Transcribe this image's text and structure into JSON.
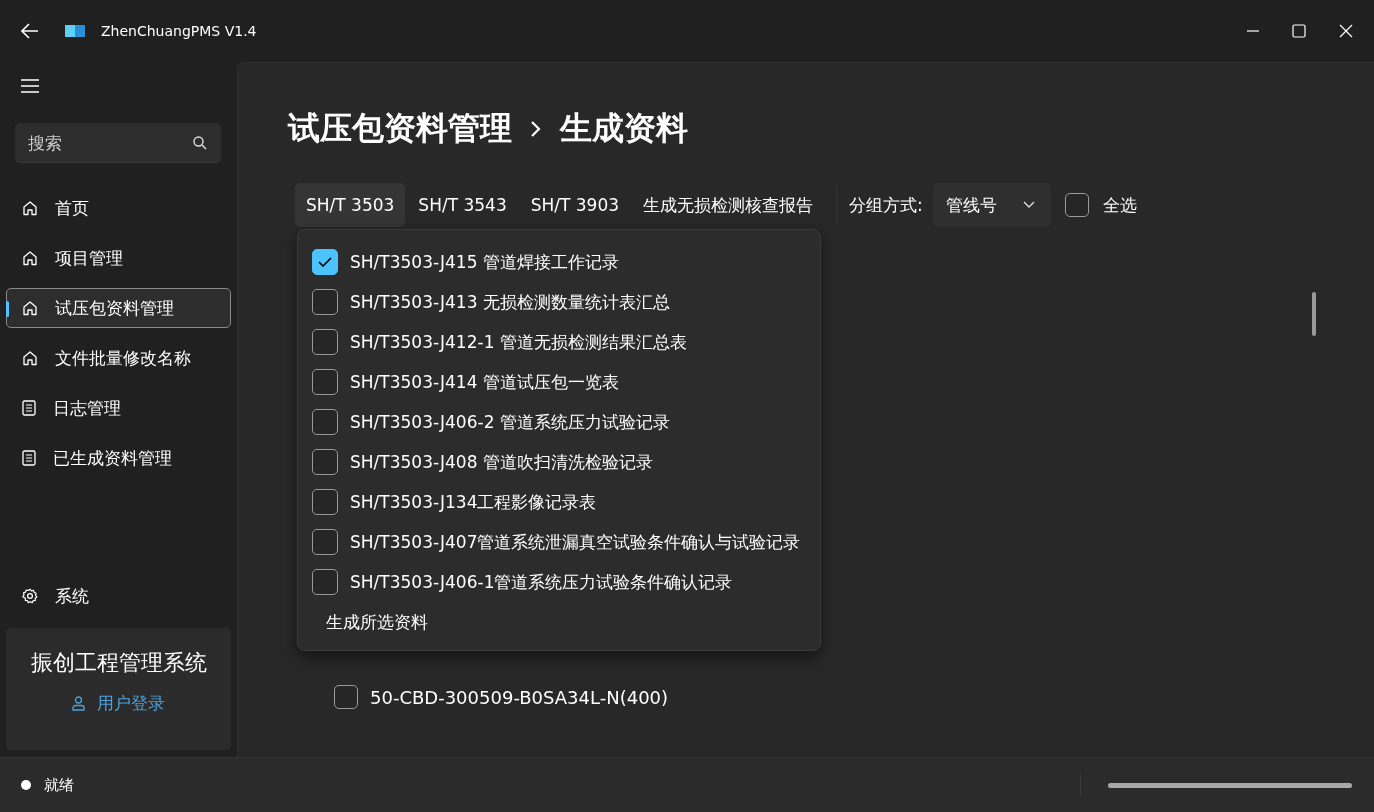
{
  "window": {
    "title": "ZhenChuangPMS V1.4"
  },
  "sidebar": {
    "search": {
      "placeholder": "搜索"
    },
    "items": [
      {
        "label": "首页",
        "kind": "home",
        "selected": false
      },
      {
        "label": "项目管理",
        "kind": "home",
        "selected": false
      },
      {
        "label": "试压包资料管理",
        "kind": "home",
        "selected": true
      },
      {
        "label": "文件批量修改名称",
        "kind": "home",
        "selected": false
      },
      {
        "label": "日志管理",
        "kind": "document",
        "selected": false
      },
      {
        "label": "已生成资料管理",
        "kind": "document",
        "selected": false
      }
    ],
    "footer_item": {
      "label": "系统"
    },
    "card": {
      "title": "振创工程管理系统",
      "login": "用户登录"
    }
  },
  "breadcrumb": [
    "试压包资料管理",
    "生成资料"
  ],
  "toolbar": {
    "tabs": [
      {
        "label": "SH/T 3503",
        "selected": true
      },
      {
        "label": "SH/T 3543",
        "selected": false
      },
      {
        "label": "SH/T 3903",
        "selected": false
      },
      {
        "label": "生成无损检测核查报告",
        "selected": false
      }
    ],
    "group_label": "分组方式:",
    "group_select": {
      "value": "管线号"
    },
    "select_all": {
      "label": "全选",
      "checked": false
    }
  },
  "flyout": {
    "items": [
      {
        "label": "SH/T3503-J415 管道焊接工作记录",
        "checked": true
      },
      {
        "label": "SH/T3503-J413 无损检测数量统计表汇总",
        "checked": false
      },
      {
        "label": "SH/T3503-J412-1 管道无损检测结果汇总表",
        "checked": false
      },
      {
        "label": "SH/T3503-J414 管道试压包一览表",
        "checked": false
      },
      {
        "label": "SH/T3503-J406-2 管道系统压力试验记录",
        "checked": false
      },
      {
        "label": "SH/T3503-J408 管道吹扫清洗检验记录",
        "checked": false
      },
      {
        "label": "SH/T3503-J134工程影像记录表",
        "checked": false
      },
      {
        "label": "SH/T3503-J407管道系统泄漏真空试验条件确认与试验记录",
        "checked": false
      },
      {
        "label": "SH/T3503-J406-1管道系统压力试验条件确认记录",
        "checked": false
      }
    ],
    "action": "生成所选资料"
  },
  "list": {
    "rows": [
      {
        "label": "50-CBD-300509-B0SA34L-N(400)",
        "checked": false
      }
    ]
  },
  "status_bar": {
    "text": "就绪",
    "progress": {
      "level": 1
    }
  }
}
